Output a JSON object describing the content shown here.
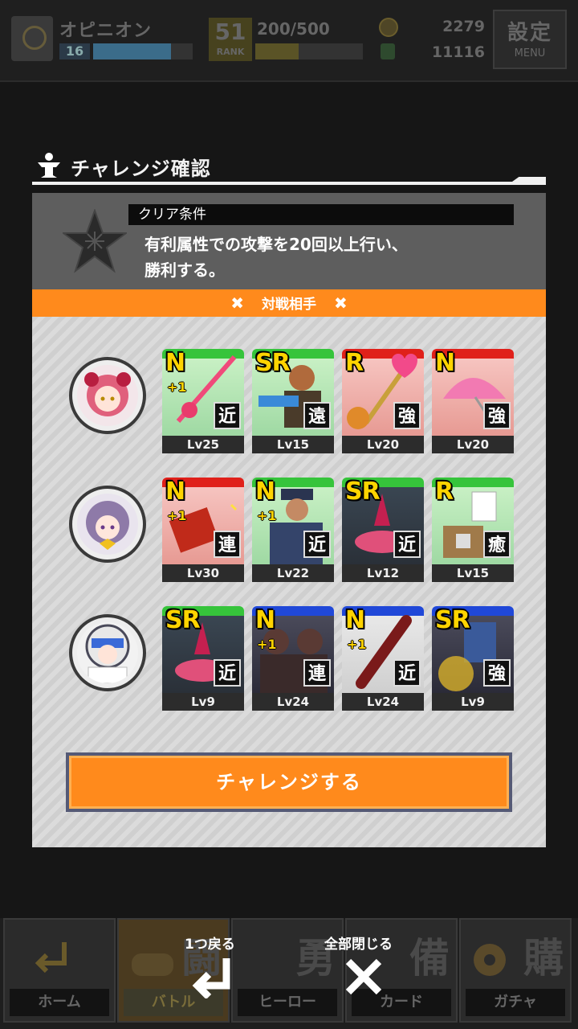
{
  "status": {
    "player_name": "オピニオン",
    "player_level": "16",
    "level_progress": 0.78,
    "rank_number": "51",
    "rank_label": "RANK",
    "stamina": "200/500",
    "stamina_progress": 0.4,
    "coins": "2279",
    "gems": "11116",
    "menu_big": "設定",
    "menu_small": "MENU"
  },
  "dialog": {
    "title": "チャレンジ確認",
    "condition_label": "クリア条件",
    "condition_line1": "有利属性での攻撃を20回以上行い、",
    "condition_line2": "勝利する。",
    "opponents_label": "対戦相手",
    "challenge_button": "チャレンジする"
  },
  "opponents": [
    {
      "portrait": "pink-haired-girl",
      "cards": [
        {
          "rarity": "N",
          "plus": "+1",
          "type": "近",
          "level": "Lv25",
          "frame": "green"
        },
        {
          "rarity": "SR",
          "plus": "",
          "type": "遠",
          "level": "Lv15",
          "frame": "green"
        },
        {
          "rarity": "R",
          "plus": "",
          "type": "強",
          "level": "Lv20",
          "frame": "red"
        },
        {
          "rarity": "N",
          "plus": "",
          "type": "強",
          "level": "Lv20",
          "frame": "red"
        }
      ]
    },
    {
      "portrait": "purple-haired-girl",
      "cards": [
        {
          "rarity": "N",
          "plus": "+1",
          "type": "連",
          "level": "Lv30",
          "frame": "red"
        },
        {
          "rarity": "N",
          "plus": "+1",
          "type": "近",
          "level": "Lv22",
          "frame": "green"
        },
        {
          "rarity": "SR",
          "plus": "",
          "type": "近",
          "level": "Lv12",
          "frame": "green"
        },
        {
          "rarity": "R",
          "plus": "",
          "type": "癒",
          "level": "Lv15",
          "frame": "green"
        }
      ]
    },
    {
      "portrait": "astronaut-girl",
      "cards": [
        {
          "rarity": "SR",
          "plus": "",
          "type": "近",
          "level": "Lv9",
          "frame": "green"
        },
        {
          "rarity": "N",
          "plus": "+1",
          "type": "連",
          "level": "Lv24",
          "frame": "blue"
        },
        {
          "rarity": "N",
          "plus": "+1",
          "type": "近",
          "level": "Lv24",
          "frame": "blue"
        },
        {
          "rarity": "SR",
          "plus": "",
          "type": "強",
          "level": "Lv9",
          "frame": "blue"
        }
      ]
    }
  ],
  "overlay": {
    "back_label": "1つ戻る",
    "close_all_label": "全部閉じる"
  },
  "nav": [
    {
      "big": "",
      "label": "ホーム",
      "active": false
    },
    {
      "big": "闘",
      "label": "バトル",
      "active": true
    },
    {
      "big": "勇",
      "label": "ヒーロー",
      "active": false
    },
    {
      "big": "備",
      "label": "カード",
      "active": false
    },
    {
      "big": "購",
      "label": "ガチャ",
      "active": false
    }
  ],
  "colors": {
    "accent_orange": "#ff8a1c",
    "frame_green": "#36c43b",
    "frame_red": "#e0201a",
    "frame_blue": "#2048d8",
    "rarity_yellow": "#ffd400"
  }
}
